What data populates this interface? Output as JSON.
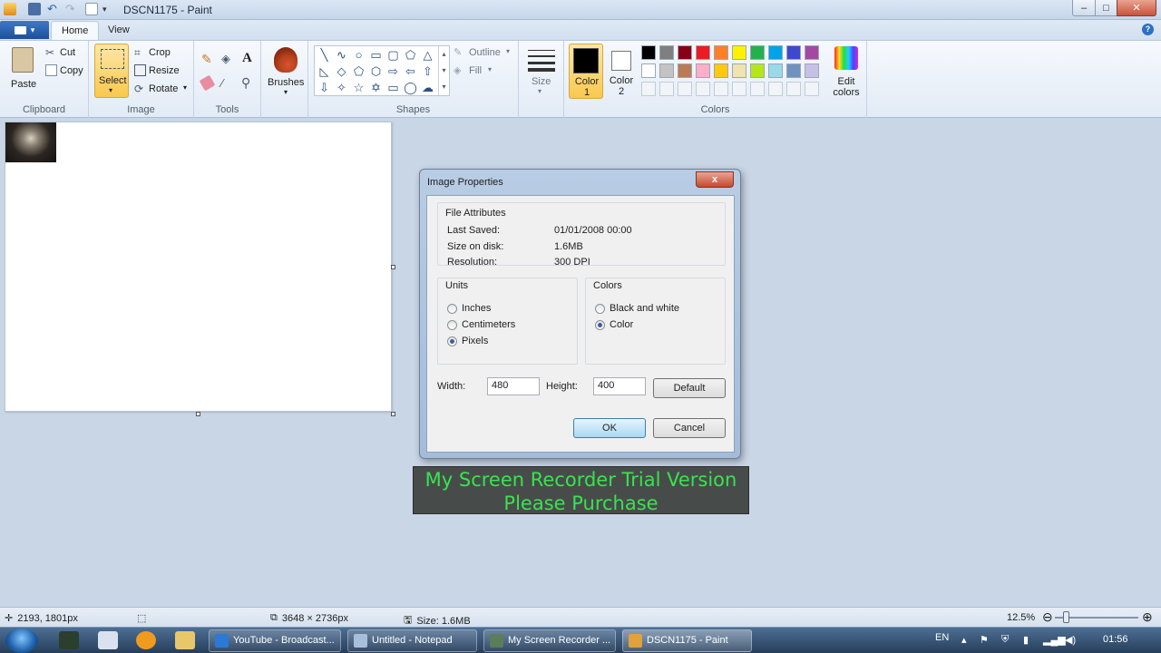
{
  "window": {
    "title": "DSCN1175 - Paint",
    "minimize": "–",
    "maximize": "□",
    "close": "✕"
  },
  "tabs": [
    {
      "label": "Home",
      "active": true
    },
    {
      "label": "View",
      "active": false
    }
  ],
  "ribbon": {
    "clipboard": {
      "paste": "Paste",
      "cut": "Cut",
      "copy": "Copy",
      "group": "Clipboard"
    },
    "image": {
      "select": "Select",
      "crop": "Crop",
      "resize": "Resize",
      "rotate": "Rotate",
      "group": "Image"
    },
    "tools": {
      "group": "Tools",
      "text_tool": "A"
    },
    "brushes": {
      "label": "Brushes"
    },
    "shapes": {
      "outline": "Outline",
      "fill": "Fill",
      "group": "Shapes"
    },
    "size": {
      "label": "Size"
    },
    "colors": {
      "color1": "Color 1",
      "color2": "Color 2",
      "edit": "Edit colors",
      "group": "Colors",
      "color1_value": "#000000",
      "color2_value": "#ffffff",
      "palette_row1": [
        "#000000",
        "#7f7f7f",
        "#880015",
        "#ed1c24",
        "#ff7f27",
        "#fff200",
        "#22b14c",
        "#00a2e8",
        "#3f48cc",
        "#a349a4"
      ],
      "palette_row2": [
        "#ffffff",
        "#c3c3c3",
        "#b97a57",
        "#ffaec9",
        "#ffc90e",
        "#efe4b0",
        "#b5e61d",
        "#99d9ea",
        "#7092be",
        "#c8bfe7"
      ]
    }
  },
  "dialog": {
    "title": "Image Properties",
    "close": "x",
    "file_attributes": {
      "legend": "File Attributes",
      "last_saved_label": "Last Saved:",
      "last_saved_value": "01/01/2008 00:00",
      "size_label": "Size on disk:",
      "size_value": "1.6MB",
      "resolution_label": "Resolution:",
      "resolution_value": "300 DPI"
    },
    "units": {
      "legend": "Units",
      "options": [
        "Inches",
        "Centimeters",
        "Pixels"
      ],
      "selected": "Pixels"
    },
    "colors": {
      "legend": "Colors",
      "options": [
        "Black and white",
        "Color"
      ],
      "selected": "Color"
    },
    "width_label": "Width:",
    "width_value": "480",
    "height_label": "Height:",
    "height_value": "400",
    "default_button": "Default",
    "ok_button": "OK",
    "cancel_button": "Cancel"
  },
  "watermark": {
    "line1": "My Screen Recorder Trial Version",
    "line2": "Please Purchase"
  },
  "statusbar": {
    "cursor_pos": "2193, 1801px",
    "dimensions": "3648 × 2736px",
    "size": "Size: 1.6MB",
    "zoom": "12.5%",
    "zoom_fraction": 0.12
  },
  "taskbar": {
    "tasks": [
      {
        "label": "YouTube - Broadcast...",
        "active": false
      },
      {
        "label": "Untitled - Notepad",
        "active": false
      },
      {
        "label": "My Screen Recorder ...",
        "active": false
      },
      {
        "label": "DSCN1175 - Paint",
        "active": true
      }
    ],
    "language": "EN",
    "clock": "01:56"
  }
}
